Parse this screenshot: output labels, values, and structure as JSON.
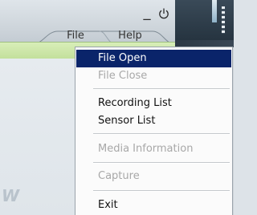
{
  "window": {
    "minimize_glyph": "_",
    "power_glyph": "⏻"
  },
  "menubar": {
    "file_label": "File",
    "help_label": "Help"
  },
  "logo_partial": "W",
  "file_menu": {
    "items": [
      {
        "label": "File Open",
        "state": "selected"
      },
      {
        "label": "File Close",
        "state": "disabled"
      },
      {
        "label": "Recording List",
        "state": "enabled"
      },
      {
        "label": "Sensor List",
        "state": "enabled"
      },
      {
        "label": "Media Information",
        "state": "disabled"
      },
      {
        "label": "Capture",
        "state": "disabled"
      },
      {
        "label": "Exit",
        "state": "enabled"
      }
    ]
  },
  "colors": {
    "selection": "#0a246a",
    "accent_green": "#c3e09c",
    "disabled_text": "#a8a8a8"
  }
}
